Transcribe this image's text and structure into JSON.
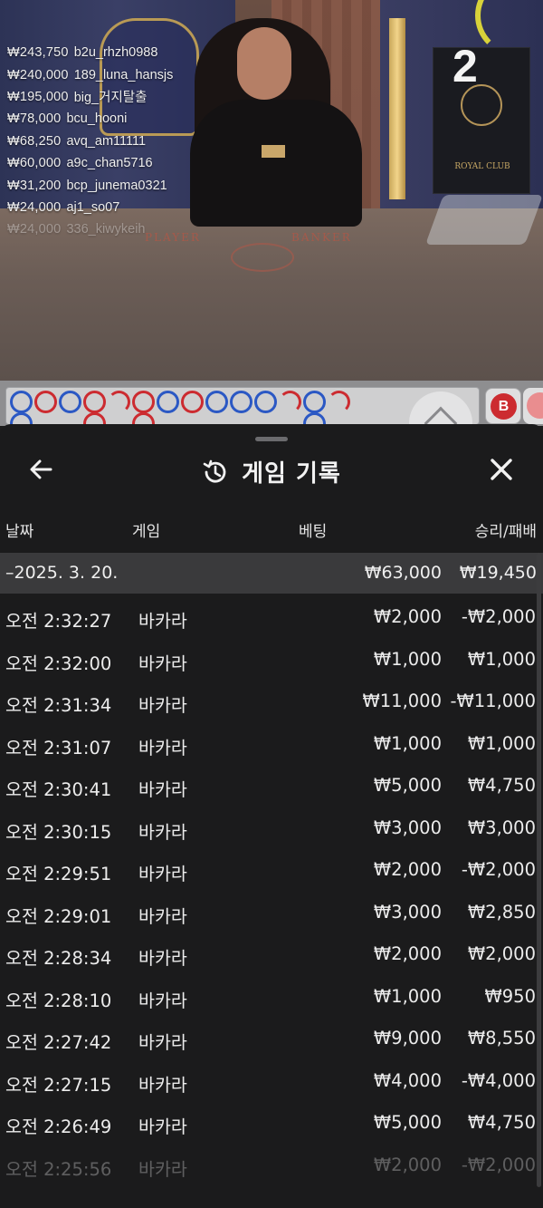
{
  "stream": {
    "countdown": "2",
    "table_labels": {
      "player": "PLAYER",
      "banker": "BANKER"
    },
    "card_box_title": "ROYAL CLUB",
    "chat": [
      {
        "amount": "₩243,750",
        "user": "b2u_rhzh0988"
      },
      {
        "amount": "₩240,000",
        "user": "189_luna_hansjs"
      },
      {
        "amount": "₩195,000",
        "user": "big_거지탈출"
      },
      {
        "amount": "₩78,000",
        "user": "bcu_hooni"
      },
      {
        "amount": "₩68,250",
        "user": "avq_am11111"
      },
      {
        "amount": "₩60,000",
        "user": "a9c_chan5716"
      },
      {
        "amount": "₩31,200",
        "user": "bcp_junema0321"
      },
      {
        "amount": "₩24,000",
        "user": "aj1_so07"
      },
      {
        "amount": "₩24,000",
        "user": "336_kiwykeih"
      }
    ]
  },
  "road": {
    "banker_button": "B",
    "row1": [
      "b",
      "r",
      "b",
      "r",
      "half",
      "r",
      "b",
      "r",
      "b",
      "b",
      "b",
      "half",
      "b",
      "half"
    ],
    "row2": [
      "b",
      "",
      "",
      "r",
      "",
      "r",
      "",
      "",
      "",
      "",
      "",
      "",
      "b",
      ""
    ]
  },
  "history": {
    "title": "게임 기록",
    "icons": {
      "back": "arrow-left-icon",
      "history": "history-clock-icon",
      "close": "close-icon"
    },
    "columns": {
      "date": "날짜",
      "game": "게임",
      "bet": "베팅",
      "result": "승리/패배"
    },
    "date_group": {
      "label": "–2025. 3. 20.",
      "bet_total": "₩63,000",
      "result_total": "₩19,450"
    },
    "rows": [
      {
        "time": "오전 2:32:27",
        "game": "바카라",
        "bet": "₩2,000",
        "result": "-₩2,000"
      },
      {
        "time": "오전 2:32:00",
        "game": "바카라",
        "bet": "₩1,000",
        "result": "₩1,000"
      },
      {
        "time": "오전 2:31:34",
        "game": "바카라",
        "bet": "₩11,000",
        "result": "-₩11,000"
      },
      {
        "time": "오전 2:31:07",
        "game": "바카라",
        "bet": "₩1,000",
        "result": "₩1,000"
      },
      {
        "time": "오전 2:30:41",
        "game": "바카라",
        "bet": "₩5,000",
        "result": "₩4,750"
      },
      {
        "time": "오전 2:30:15",
        "game": "바카라",
        "bet": "₩3,000",
        "result": "₩3,000"
      },
      {
        "time": "오전 2:29:51",
        "game": "바카라",
        "bet": "₩2,000",
        "result": "-₩2,000"
      },
      {
        "time": "오전 2:29:01",
        "game": "바카라",
        "bet": "₩3,000",
        "result": "₩2,850"
      },
      {
        "time": "오전 2:28:34",
        "game": "바카라",
        "bet": "₩2,000",
        "result": "₩2,000"
      },
      {
        "time": "오전 2:28:10",
        "game": "바카라",
        "bet": "₩1,000",
        "result": "₩950"
      },
      {
        "time": "오전 2:27:42",
        "game": "바카라",
        "bet": "₩9,000",
        "result": "₩8,550"
      },
      {
        "time": "오전 2:27:15",
        "game": "바카라",
        "bet": "₩4,000",
        "result": "-₩4,000"
      },
      {
        "time": "오전 2:26:49",
        "game": "바카라",
        "bet": "₩5,000",
        "result": "₩4,750"
      },
      {
        "time": "오전 2:25:56",
        "game": "바카라",
        "bet": "₩2,000",
        "result": "-₩2,000"
      }
    ]
  }
}
